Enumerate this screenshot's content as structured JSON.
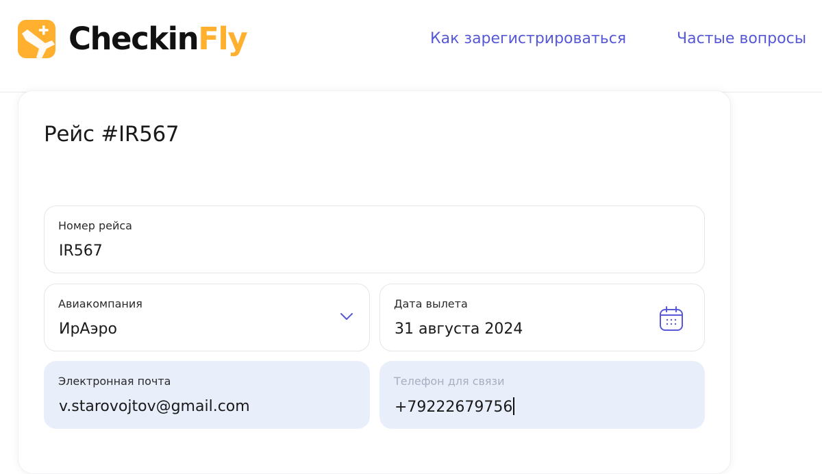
{
  "header": {
    "logo": {
      "icon": "plane-plus-icon",
      "text_part1": "Checkin",
      "text_part2": "Fly",
      "brand_color": "#ffb02e"
    },
    "nav": [
      {
        "label": "Как зарегистрироваться"
      },
      {
        "label": "Частые вопросы"
      }
    ],
    "nav_color": "#5658d6"
  },
  "card": {
    "title": "Рейс #IR567",
    "fields": {
      "flight_number": {
        "label": "Номер рейса",
        "value": "IR567"
      },
      "airline": {
        "label": "Авиакомпания",
        "value": "ИрАэро",
        "icon": "chevron-down-icon"
      },
      "departure_date": {
        "label": "Дата вылета",
        "value": "31 августа 2024",
        "icon": "calendar-icon"
      },
      "email": {
        "label": "Электронная почта",
        "value": "v.starovojtov@gmail.com"
      },
      "phone": {
        "label": "Телефон для связи",
        "value": "+79222679756"
      }
    },
    "filled_field_color": "#e9eefb"
  }
}
